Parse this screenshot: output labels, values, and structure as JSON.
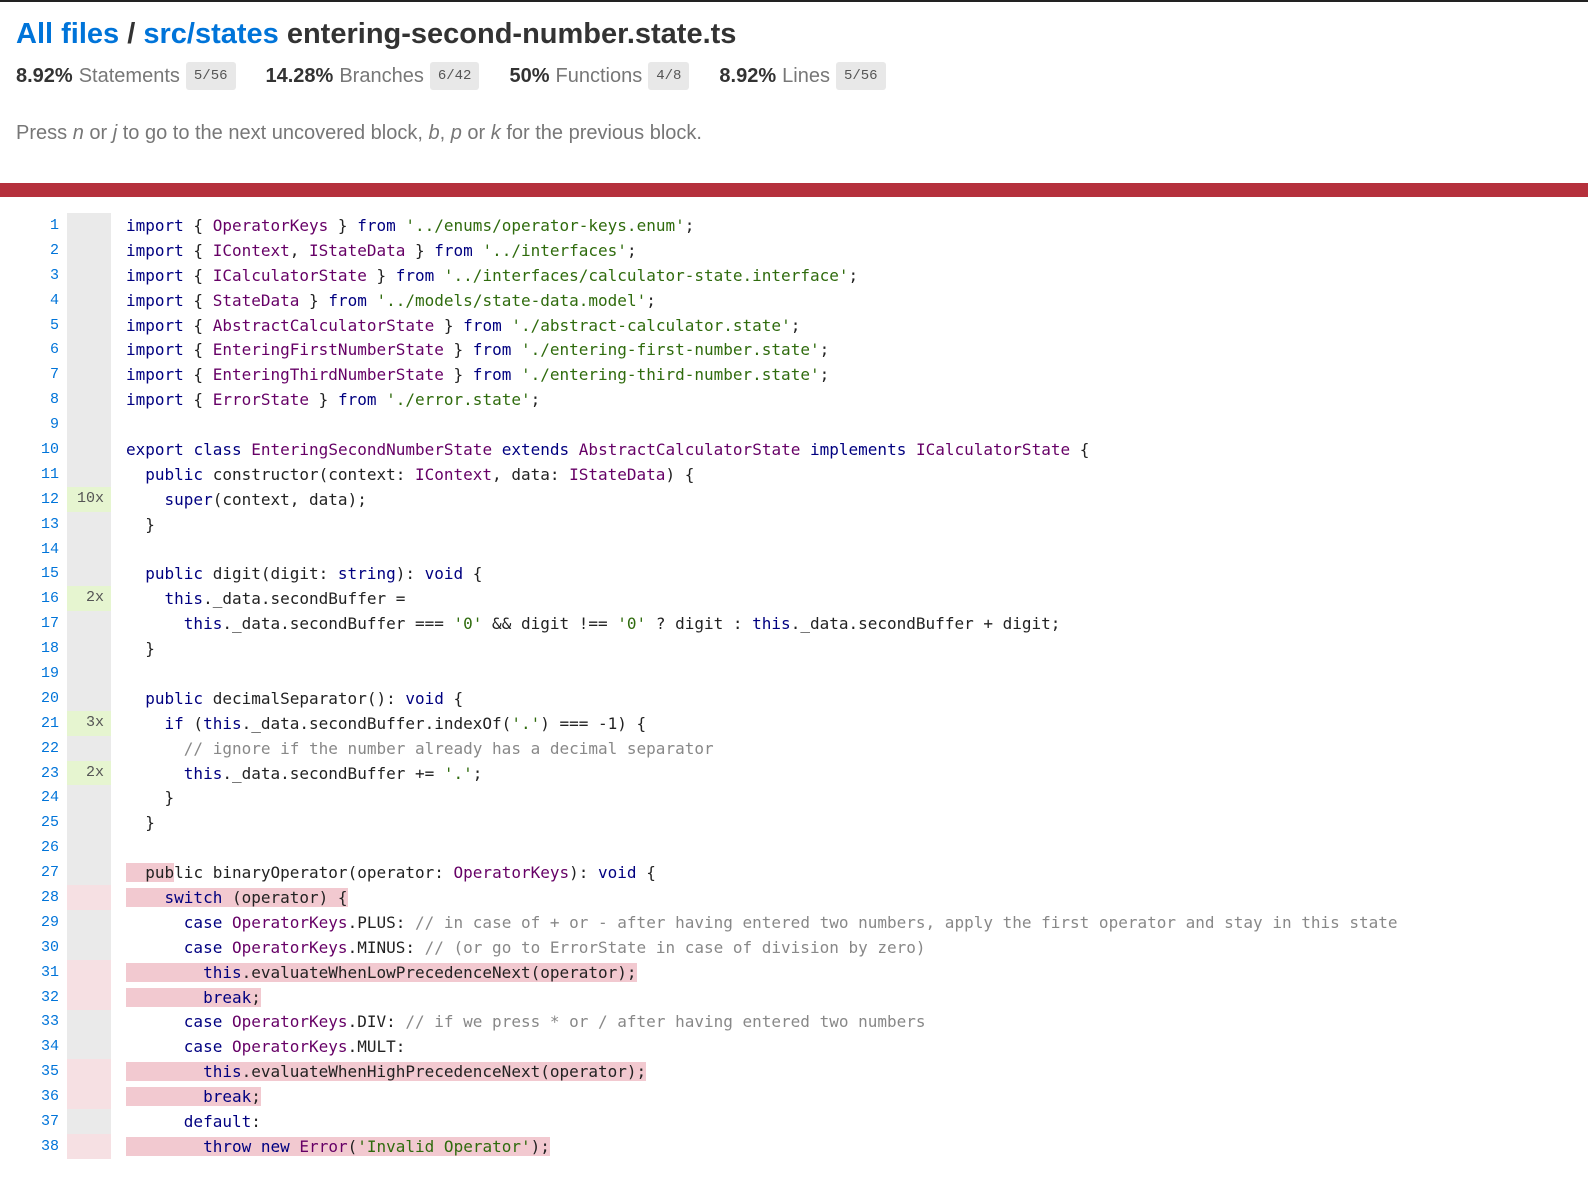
{
  "breadcrumb": {
    "all_files": "All files",
    "sep": "/",
    "dir": "src/states",
    "file": "entering-second-number.state.ts"
  },
  "summary": [
    {
      "pct": "8.92%",
      "label": "Statements",
      "fraction": "5/56"
    },
    {
      "pct": "14.28%",
      "label": "Branches",
      "fraction": "6/42"
    },
    {
      "pct": "50%",
      "label": "Functions",
      "fraction": "4/8"
    },
    {
      "pct": "8.92%",
      "label": "Lines",
      "fraction": "5/56"
    }
  ],
  "help": {
    "t1": "Press ",
    "k1": "n",
    "t2": " or ",
    "k2": "j",
    "t3": " to go to the next uncovered block, ",
    "k3": "b",
    "t4": ", ",
    "k4": "p",
    "t5": " or ",
    "k5": "k",
    "t6": " for the previous block."
  },
  "colors": {
    "status_bar": "#b5303c",
    "link": "#0074D9",
    "covered": "#e6f5d0",
    "uncovered": "#f2c9d0"
  },
  "lines": [
    {
      "n": "1",
      "hits": "",
      "state": "",
      "code": "import { OperatorKeys } from '../enums/operator-keys.enum';"
    },
    {
      "n": "2",
      "hits": "",
      "state": "",
      "code": "import { IContext, IStateData } from '../interfaces';"
    },
    {
      "n": "3",
      "hits": "",
      "state": "",
      "code": "import { ICalculatorState } from '../interfaces/calculator-state.interface';"
    },
    {
      "n": "4",
      "hits": "",
      "state": "",
      "code": "import { StateData } from '../models/state-data.model';"
    },
    {
      "n": "5",
      "hits": "",
      "state": "",
      "code": "import { AbstractCalculatorState } from './abstract-calculator.state';"
    },
    {
      "n": "6",
      "hits": "",
      "state": "",
      "code": "import { EnteringFirstNumberState } from './entering-first-number.state';"
    },
    {
      "n": "7",
      "hits": "",
      "state": "",
      "code": "import { EnteringThirdNumberState } from './entering-third-number.state';"
    },
    {
      "n": "8",
      "hits": "",
      "state": "",
      "code": "import { ErrorState } from './error.state';"
    },
    {
      "n": "9",
      "hits": "",
      "state": "",
      "code": ""
    },
    {
      "n": "10",
      "hits": "",
      "state": "",
      "code": "export class EnteringSecondNumberState extends AbstractCalculatorState implements ICalculatorState {"
    },
    {
      "n": "11",
      "hits": "",
      "state": "",
      "code": "  public constructor(context: IContext, data: IStateData) {"
    },
    {
      "n": "12",
      "hits": "10x",
      "state": "hit",
      "code": "    super(context, data);"
    },
    {
      "n": "13",
      "hits": "",
      "state": "",
      "code": "  }"
    },
    {
      "n": "14",
      "hits": "",
      "state": "",
      "code": ""
    },
    {
      "n": "15",
      "hits": "",
      "state": "",
      "code": "  public digit(digit: string): void {"
    },
    {
      "n": "16",
      "hits": "2x",
      "state": "hit",
      "code": "    this._data.secondBuffer ="
    },
    {
      "n": "17",
      "hits": "",
      "state": "",
      "code": "      this._data.secondBuffer === '0' && digit !== '0' ? digit : this._data.secondBuffer + digit;"
    },
    {
      "n": "18",
      "hits": "",
      "state": "",
      "code": "  }"
    },
    {
      "n": "19",
      "hits": "",
      "state": "",
      "code": ""
    },
    {
      "n": "20",
      "hits": "",
      "state": "",
      "code": "  public decimalSeparator(): void {"
    },
    {
      "n": "21",
      "hits": "3x",
      "state": "hit",
      "code": "    if (this._data.secondBuffer.indexOf('.') === -1) {"
    },
    {
      "n": "22",
      "hits": "",
      "state": "",
      "code": "      // ignore if the number already has a decimal separator"
    },
    {
      "n": "23",
      "hits": "2x",
      "state": "hit",
      "code": "      this._data.secondBuffer += '.';"
    },
    {
      "n": "24",
      "hits": "",
      "state": "",
      "code": "    }"
    },
    {
      "n": "25",
      "hits": "",
      "state": "",
      "code": "  }"
    },
    {
      "n": "26",
      "hits": "",
      "state": "",
      "code": ""
    },
    {
      "n": "27",
      "hits": "",
      "state": "",
      "code": "  public binaryOperator(operator: OperatorKeys): void {"
    },
    {
      "n": "28",
      "hits": "",
      "state": "miss",
      "code": "    switch (operator) {"
    },
    {
      "n": "29",
      "hits": "",
      "state": "",
      "code": "      case OperatorKeys.PLUS: // in case of + or - after having entered two numbers, apply the first operator and stay in this state"
    },
    {
      "n": "30",
      "hits": "",
      "state": "",
      "code": "      case OperatorKeys.MINUS: // (or go to ErrorState in case of division by zero)"
    },
    {
      "n": "31",
      "hits": "",
      "state": "miss",
      "code": "        this.evaluateWhenLowPrecedenceNext(operator);"
    },
    {
      "n": "32",
      "hits": "",
      "state": "miss",
      "code": "        break;"
    },
    {
      "n": "33",
      "hits": "",
      "state": "",
      "code": "      case OperatorKeys.DIV: // if we press * or / after having entered two numbers"
    },
    {
      "n": "34",
      "hits": "",
      "state": "",
      "code": "      case OperatorKeys.MULT:"
    },
    {
      "n": "35",
      "hits": "",
      "state": "miss",
      "code": "        this.evaluateWhenHighPrecedenceNext(operator);"
    },
    {
      "n": "36",
      "hits": "",
      "state": "miss",
      "code": "        break;"
    },
    {
      "n": "37",
      "hits": "",
      "state": "",
      "code": "      default:"
    },
    {
      "n": "38",
      "hits": "",
      "state": "miss",
      "code": "        throw new Error('Invalid Operator');"
    }
  ]
}
